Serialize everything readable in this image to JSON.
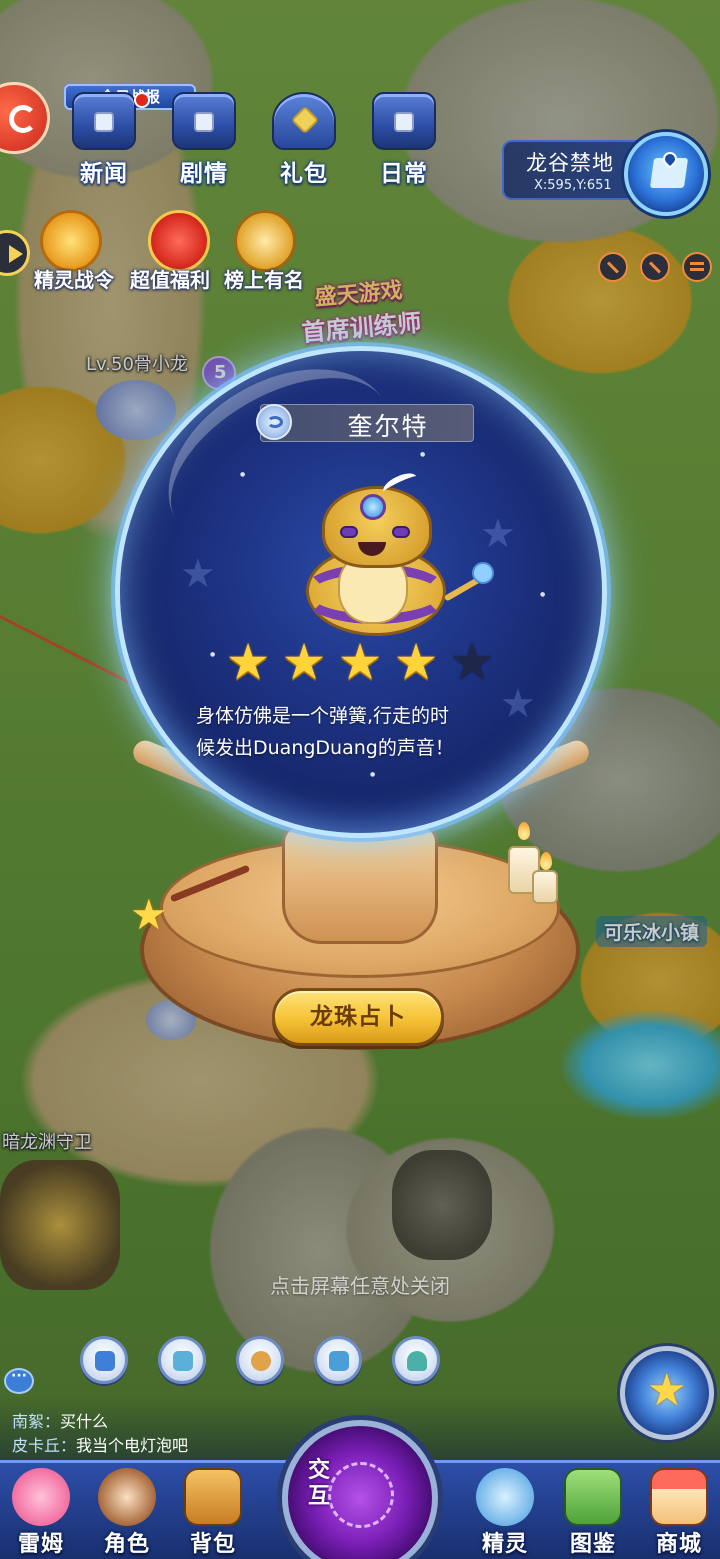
{
  "top_nav": {
    "items": [
      {
        "label": "新闻",
        "icon": "news-board-icon"
      },
      {
        "label": "剧情",
        "icon": "story-book-icon"
      },
      {
        "label": "礼包",
        "icon": "gift-chest-icon"
      },
      {
        "label": "日常",
        "icon": "daily-calendar-icon"
      }
    ],
    "sign_text": "今日战报"
  },
  "features": {
    "items": [
      {
        "label": "精灵战令",
        "icon": "battle-pass-icon"
      },
      {
        "label": "超值福利",
        "icon": "welfare-gift-icon"
      },
      {
        "label": "榜上有名",
        "icon": "ranking-trophy-icon"
      }
    ]
  },
  "location": {
    "name": "龙谷禁地",
    "coords": "X:595,Y:651"
  },
  "world": {
    "npc_lv50": "Lv.50骨小龙",
    "npc_guard": "暗龙渊守卫",
    "event_line1": "盛天游戏",
    "event_line2": "首席训练师",
    "town": "可乐冰小镇",
    "level_badge": "5"
  },
  "popup": {
    "pet_name": "奎尔特",
    "stars_filled": 4,
    "stars_total": 5,
    "description_line1": "身体仿佛是一个弹簧,行走的时",
    "description_line2": "候发出DuangDuang的声音！",
    "divine_button": "龙珠占卜",
    "close_hint": "点击屏幕任意处关闭"
  },
  "chat": {
    "messages": [
      {
        "user": "南絮：",
        "text": "买什么"
      },
      {
        "user": "皮卡丘：",
        "text": "我当个电灯泡吧"
      }
    ]
  },
  "dock": {
    "items": [
      {
        "label": "雷姆",
        "icon": "pink-pet-icon"
      },
      {
        "label": "角色",
        "icon": "character-icon"
      },
      {
        "label": "背包",
        "icon": "backpack-icon"
      },
      {
        "label": "精灵",
        "icon": "spirit-icon"
      },
      {
        "label": "图鉴",
        "icon": "encyclopedia-icon"
      },
      {
        "label": "商城",
        "icon": "shop-icon"
      }
    ],
    "center_label": "交互"
  },
  "colors": {
    "accent_gold": "#ffd43b",
    "dock_blue": "#233f8c",
    "orb_blue": "#1d3282"
  }
}
